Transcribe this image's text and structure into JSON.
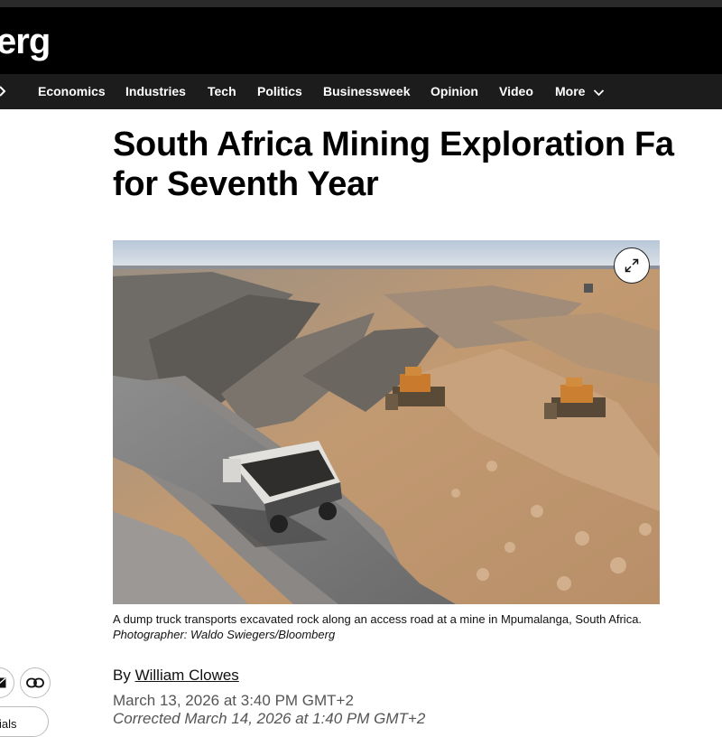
{
  "brand": {
    "logo_text": "erg",
    "nav_bg": "#1c1c1c",
    "header_bg": "#000000"
  },
  "nav": {
    "items": [
      "Economics",
      "Industries",
      "Tech",
      "Politics",
      "Businessweek",
      "Opinion",
      "Video"
    ],
    "more_label": "More"
  },
  "article": {
    "headline": "South Africa Mining Exploration Fa for Seventh Year",
    "headline_line1": "South Africa Mining Exploration Fa",
    "headline_line2": "for Seventh Year",
    "image": {
      "alt_description": "Open-pit mine with dump truck and bulldozers",
      "caption": "A dump truck transports excavated rock along an access road at a mine in Mpumalanga, South Africa.",
      "credit": "Photographer: Waldo Swiegers/Bloomberg"
    },
    "byline_prefix": "By",
    "author": "William Clowes",
    "published": "March 13, 2026 at 3:40 PM GMT+2",
    "corrected": "Corrected March 14, 2026 at 1:40 PM GMT+2"
  },
  "share": {
    "side_label": "ials"
  },
  "icons": {
    "expand": "expand-icon",
    "email": "email-icon",
    "link": "link-icon",
    "more_chevron": "chevron-down-icon",
    "nav_chevron": "chevron-right-icon"
  }
}
